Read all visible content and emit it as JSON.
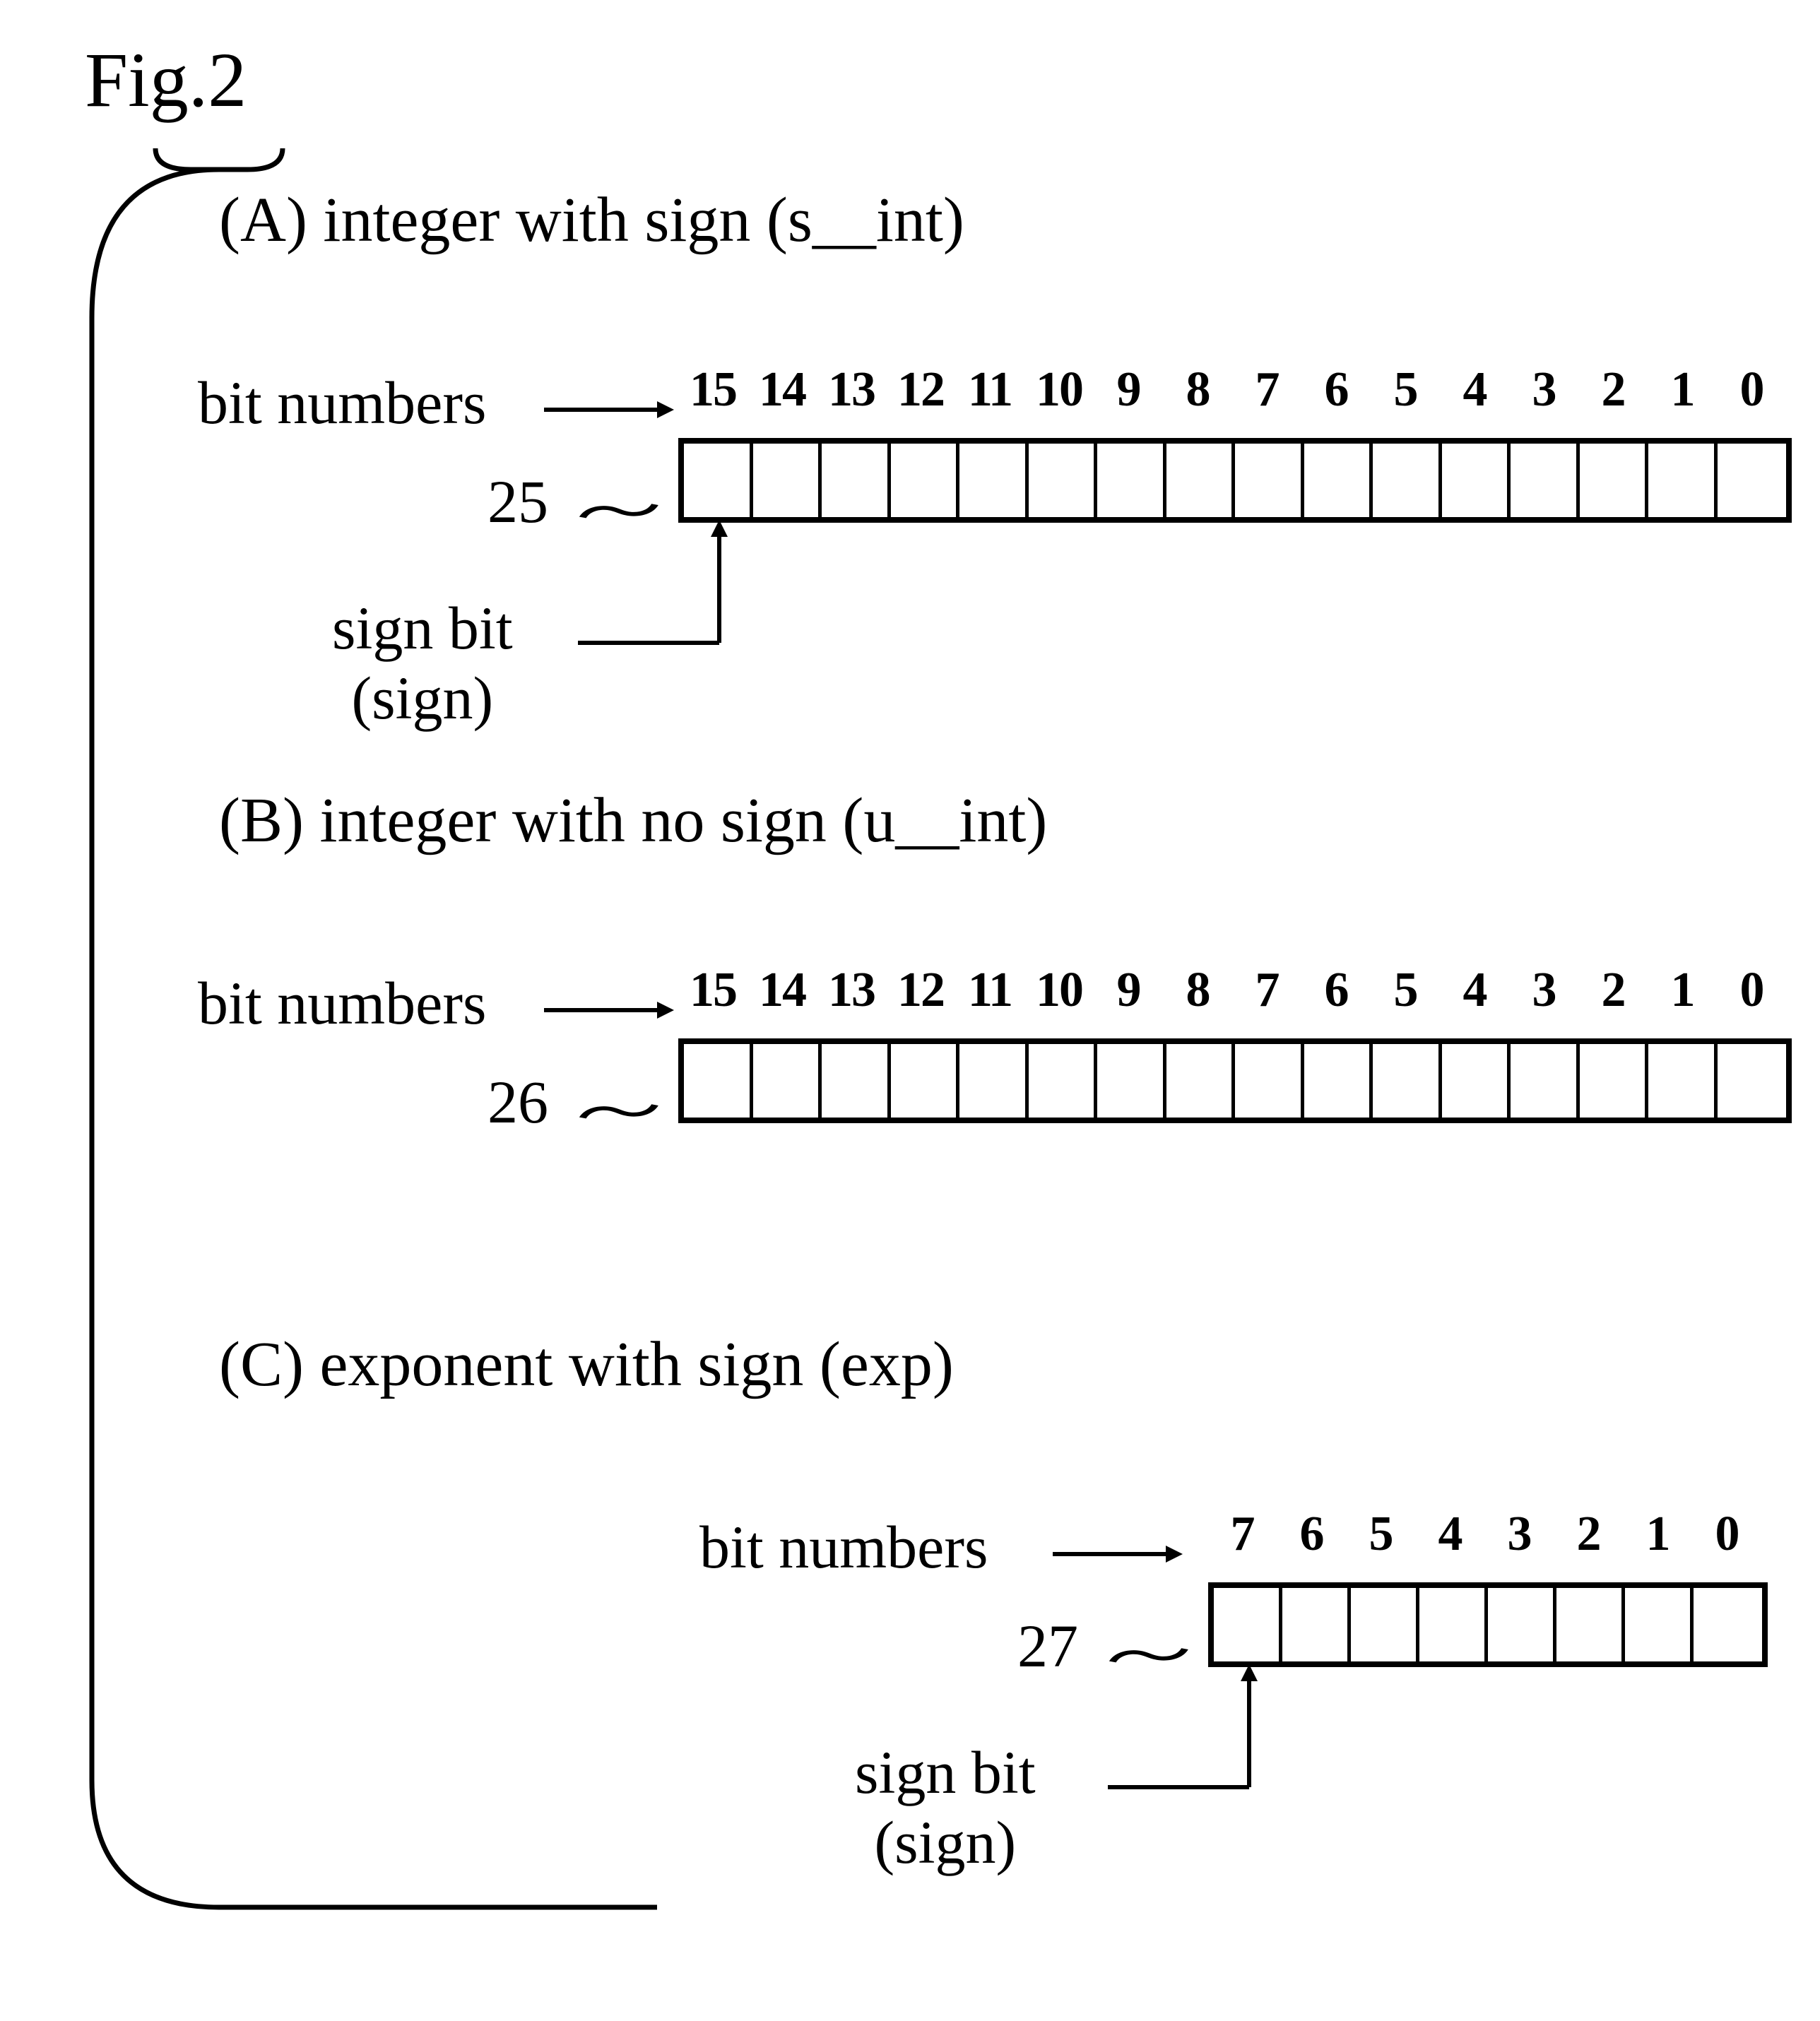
{
  "figure_title": "Fig.2",
  "bit_numbers_label": "bit numbers",
  "sign_bit_label_line1": "sign bit",
  "sign_bit_label_line2": "(sign)",
  "sections": {
    "a": {
      "title": "(A)  integer  with  sign  (s__int)",
      "ref": "25",
      "bits": [
        "15",
        "14",
        "13",
        "12",
        "11",
        "10",
        "9",
        "8",
        "7",
        "6",
        "5",
        "4",
        "3",
        "2",
        "1",
        "0"
      ]
    },
    "b": {
      "title": "(B)  integer  with  no  sign  (u__int)",
      "ref": "26",
      "bits": [
        "15",
        "14",
        "13",
        "12",
        "11",
        "10",
        "9",
        "8",
        "7",
        "6",
        "5",
        "4",
        "3",
        "2",
        "1",
        "0"
      ]
    },
    "c": {
      "title": "(C)  exponent  with  sign    (exp)",
      "ref": "27",
      "bits": [
        "7",
        "6",
        "5",
        "4",
        "3",
        "2",
        "1",
        "0"
      ]
    }
  }
}
